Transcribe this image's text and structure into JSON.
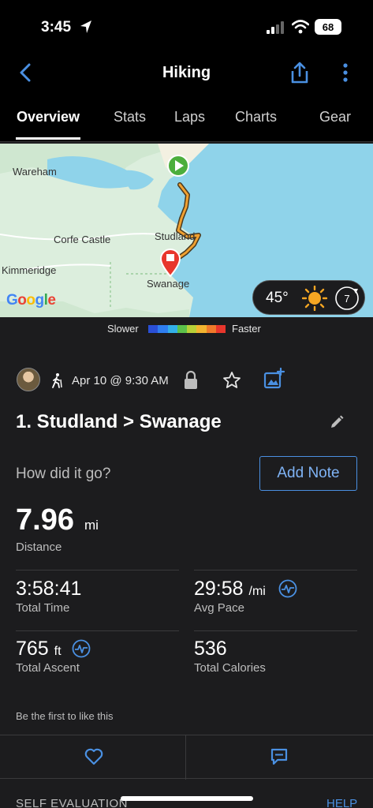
{
  "status_bar": {
    "time": "3:45",
    "battery": "68"
  },
  "nav": {
    "title": "Hiking",
    "back_icon": "chevron-left-icon",
    "share_icon": "share-icon",
    "more_icon": "more-vertical-icon"
  },
  "tabs": [
    {
      "label": "Overview",
      "active": true
    },
    {
      "label": "Stats",
      "active": false
    },
    {
      "label": "Laps",
      "active": false
    },
    {
      "label": "Charts",
      "active": false
    },
    {
      "label": "Gear",
      "active": false
    }
  ],
  "map": {
    "labels": {
      "wareham": "Wareham",
      "corfe": "Corfe Castle",
      "studland": "Studland",
      "kimmeridge": "Kimmeridge",
      "swanage": "Swanage"
    },
    "google_logo": "Google",
    "weather": {
      "temperature": "45°",
      "wind": "7"
    }
  },
  "pace_legend": {
    "slower": "Slower",
    "faster": "Faster",
    "colors": [
      "#2a4fd6",
      "#2f7ef0",
      "#33b0e8",
      "#5cc14a",
      "#b8d038",
      "#f2b430",
      "#f07a2a",
      "#e8362c"
    ]
  },
  "activity": {
    "date": "Apr 10 @ 9:30 AM",
    "title": "1. Studland > Swanage",
    "how_did_it_go": "How did it go?",
    "add_note": "Add Note"
  },
  "stats": {
    "distance": {
      "value": "7.96",
      "unit": "mi",
      "label": "Distance"
    },
    "total_time": {
      "value": "3:58:41",
      "label": "Total Time"
    },
    "avg_pace": {
      "value": "29:58",
      "unit": "/mi",
      "label": "Avg Pace"
    },
    "total_ascent": {
      "value": "765",
      "unit": "ft",
      "label": "Total Ascent"
    },
    "total_calories": {
      "value": "536",
      "label": "Total Calories"
    }
  },
  "social": {
    "likes_text": "Be the first to like this"
  },
  "footer": {
    "section_title": "SELF EVALUATION",
    "help": "HELP"
  }
}
